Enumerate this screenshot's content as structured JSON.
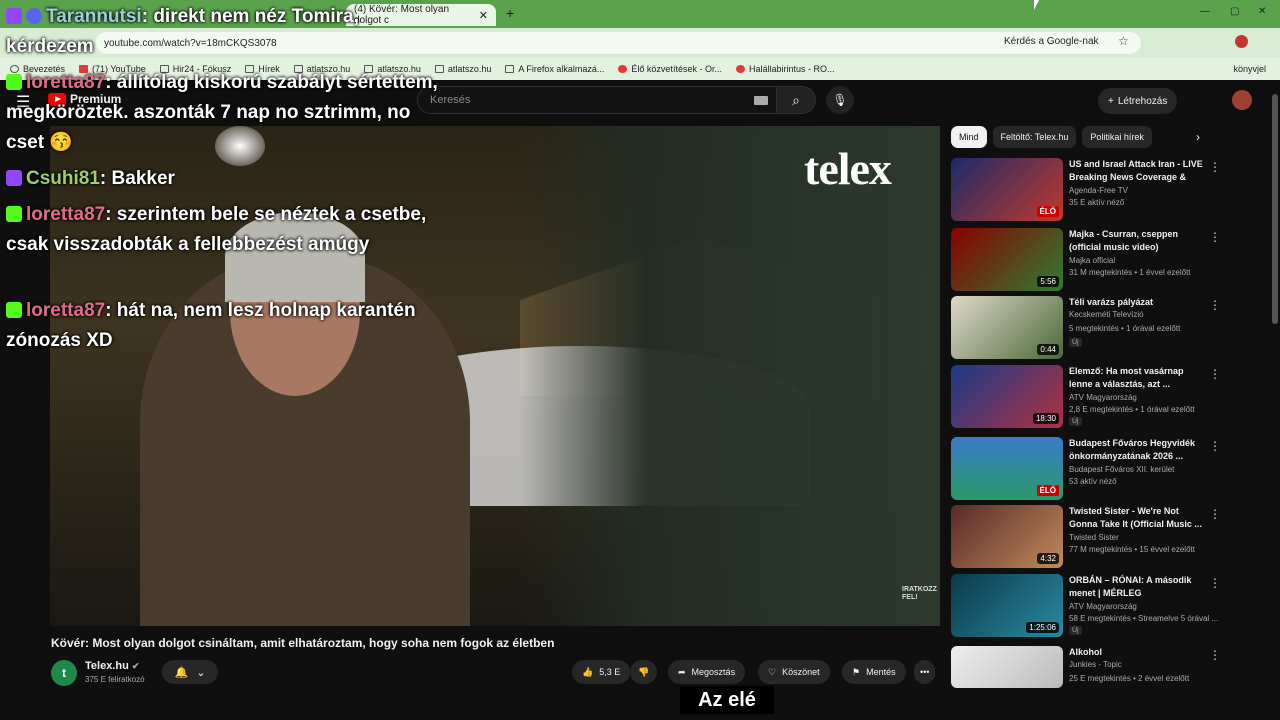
{
  "browser": {
    "active_tab_title": "(4) Kövér: Most olyan dolgot c",
    "url": "youtube.com/watch?v=18mCKQS3078",
    "google_search_label": "Kérdés a Google-nak",
    "bookmarks": [
      "Bevezetés",
      "(71) YouTube",
      "Hir24 - Fókusz",
      "Hírek",
      "atlatszo.hu",
      "atlatszo.hu",
      "atlatszo.hu",
      "A Firefox alkalmazá...",
      "Élő közvetítések - Or...",
      "Halállabirintus - RO..."
    ],
    "bookmark_right": "könyvjel"
  },
  "youtube": {
    "logo_text": "Premium",
    "search_placeholder": "Keresés",
    "create_label": "Létrehozás"
  },
  "video": {
    "brand_watermark": "telex",
    "corner_mark": "IRATKOZZ FEL!",
    "title": "Kövér: Most olyan dolgot csináltam, amit elhatároztam, hogy soha nem fogok az életben",
    "caption": "Az elé"
  },
  "channel": {
    "avatar_letter": "t",
    "name": "Telex.hu",
    "subscribers": "375 E feliratkozó"
  },
  "actions": {
    "likes": "5,3 E",
    "share": "Megosztás",
    "thanks": "Köszönet",
    "save": "Mentés",
    "more": "•••"
  },
  "chat": [
    {
      "user": "Tarannutsi",
      "text": ": direkt nem néz Tomira, kérdezem"
    },
    {
      "user": "loretta87",
      "text": ": állítólag kiskorú szabályt sértettem, megköröztek. aszonták 7 nap no sztrimm, no cset 😚"
    },
    {
      "user": "Csuhi81",
      "text": ": Bakker"
    },
    {
      "user": "loretta87",
      "text": ": szerintem bele se néztek a csetbe, csak visszadobták a fellebbezést amúgy"
    },
    {
      "user": "loretta87",
      "text": ": hát na, nem lesz holnap karantén zónozás XD"
    }
  ],
  "chips": [
    "Mind",
    "Feltöltő: Telex.hu",
    "Politikai hírek"
  ],
  "recommendations": [
    {
      "title": "US and Israel Attack Iran - LIVE Breaking News Coverage & W...",
      "channel": "Agenda-Free TV",
      "meta": "35 E aktív néző",
      "badge": "ÉLŐ",
      "is_live": true,
      "new": ""
    },
    {
      "title": "Majka - Csurran, cseppen (official music video)",
      "channel": "Majka official",
      "meta": "31 M megtekintés • 1 évvel ezelőtt",
      "badge": "5:56",
      "is_live": false,
      "new": ""
    },
    {
      "title": "Téli varázs pályázat",
      "channel": "Kecskeméti Televízió",
      "meta": "5 megtekintés • 1 órával ezelőtt",
      "badge": "0:44",
      "is_live": false,
      "new": "Új"
    },
    {
      "title": "Elemző: Ha most vasárnap lenne a választás, azt ...",
      "channel": "ATV Magyarország",
      "meta": "2,8 E megtekintés • 1 órával ezelőtt",
      "badge": "18:30",
      "is_live": false,
      "new": "Új"
    },
    {
      "title": "Budapest Főváros Hegyvidék önkormányzatának 2026 ...",
      "channel": "Budapest Főváros XII. kerület",
      "meta": "53 aktív néző",
      "badge": "ÉLŐ",
      "is_live": true,
      "new": ""
    },
    {
      "title": "Twisted Sister - We're Not Gonna Take It (Official Music ...",
      "channel": "Twisted Sister",
      "meta": "77 M megtekintés • 15 évvel ezelőtt",
      "badge": "4:32",
      "is_live": false,
      "new": ""
    },
    {
      "title": "ORBÁN – RÓNAI: A második menet | MÉRLEG",
      "channel": "ATV Magyarország",
      "meta": "58 E megtekintés • Streamelve 5 órával ...",
      "badge": "1:25:06",
      "is_live": false,
      "new": "Új"
    },
    {
      "title": "Alkohol",
      "channel": "Junkies - Topic",
      "meta": "25 E megtekintés • 2 évvel ezelőtt",
      "badge": "",
      "is_live": false,
      "new": ""
    }
  ],
  "colors": {
    "accent": "#ff0000",
    "tab_green": "#5aa34c",
    "bg": "#0f0f0f"
  }
}
